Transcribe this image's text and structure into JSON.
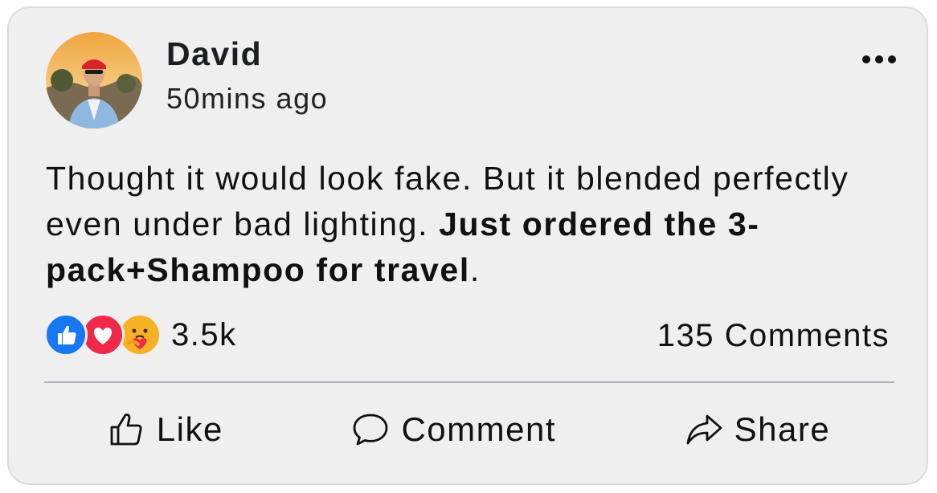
{
  "post": {
    "author": "David",
    "timestamp": "50mins ago",
    "text_plain": "Thought it would look fake. But it blended perfectly even under bad lighting. ",
    "text_bold": "Just ordered the 3-pack+Shampoo for travel",
    "text_end": "."
  },
  "stats": {
    "reaction_count": "3.5k",
    "comments": "135 Comments",
    "reactions": [
      "like-icon",
      "love-icon",
      "care-icon"
    ]
  },
  "actions": {
    "like": "Like",
    "comment": "Comment",
    "share": "Share"
  },
  "colors": {
    "like": "#1877f2",
    "love": "#f02849",
    "care": "#f7b125",
    "card_bg": "#efefef",
    "divider": "#a9b3bf"
  }
}
